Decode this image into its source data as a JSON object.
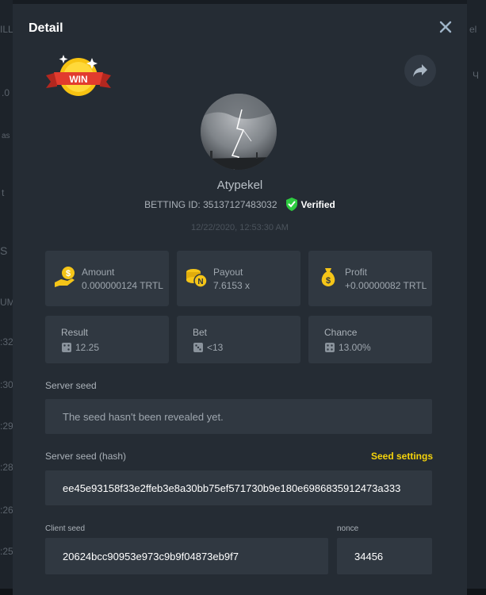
{
  "modal": {
    "title": "Detail",
    "win_badge": "WIN",
    "username": "Atypekel",
    "betting_id": "BETTING ID: 35137127483032",
    "verified": "Verified",
    "timestamp": "12/22/2020, 12:53:30 AM"
  },
  "stats": {
    "amount": {
      "label": "Amount",
      "value": "0.000000124 TRTL",
      "icon": "money-hand-icon"
    },
    "payout": {
      "label": "Payout",
      "value": "7.6153 x",
      "icon": "coins-icon"
    },
    "profit": {
      "label": "Profit",
      "value": "+0.00000082 TRTL",
      "icon": "money-bag-icon"
    },
    "result": {
      "label": "Result",
      "value": "12.25",
      "icon": "dice-icon"
    },
    "bet": {
      "label": "Bet",
      "value": "<13",
      "icon": "dice-icon"
    },
    "chance": {
      "label": "Chance",
      "value": "13.00%",
      "icon": "dice-icon"
    }
  },
  "server_seed": {
    "label": "Server seed",
    "value": "The seed hasn't been revealed yet."
  },
  "server_seed_hash": {
    "label": "Server seed (hash)",
    "settings_link": "Seed settings",
    "value": "ee45e93158f33e2ffeb3e8a30bb75ef571730b9e180e6986835912473a333"
  },
  "client_seed": {
    "label": "Client seed",
    "value": "20624bcc90953e973c9b9f04873eb9f7"
  },
  "nonce": {
    "label": "nonce",
    "value": "34456"
  },
  "background": {
    "left_fragments": [
      "ILL",
      ".0",
      "as",
      "t",
      "S",
      "UM",
      ":32",
      ":30",
      ":29",
      ":28",
      ":26",
      ":25"
    ],
    "right_fragments": [
      "el",
      "Ч"
    ]
  },
  "colors": {
    "accent": "#f5d30b",
    "verified": "#2ecc40",
    "modal_bg": "#252c34",
    "card_bg": "#303841"
  }
}
